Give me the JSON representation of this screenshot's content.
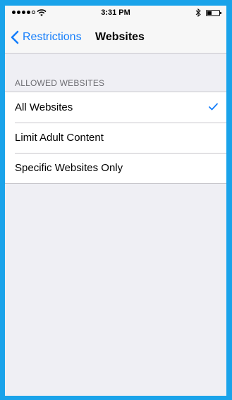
{
  "status_bar": {
    "time": "3:31 PM",
    "signal_icon": "signal-dots-icon",
    "wifi_icon": "wifi-icon",
    "bluetooth_icon": "bluetooth-icon",
    "battery_icon": "battery-icon",
    "battery_level": 0.4
  },
  "nav": {
    "back_label": "Restrictions",
    "back_icon": "chevron-left-icon",
    "title": "Websites"
  },
  "section": {
    "header": "ALLOWED WEBSITES",
    "options": [
      {
        "label": "All Websites",
        "selected": true
      },
      {
        "label": "Limit Adult Content",
        "selected": false
      },
      {
        "label": "Specific Websites Only",
        "selected": false
      }
    ]
  },
  "colors": {
    "accent": "#157efb",
    "frame": "#1aa3ea",
    "background": "#efeff4"
  }
}
